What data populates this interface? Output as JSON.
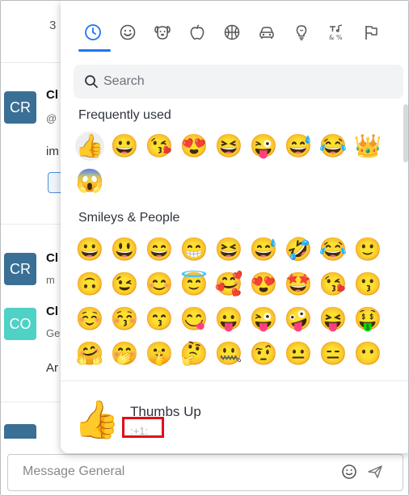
{
  "chat": {
    "unread_count": "3",
    "messages": [
      {
        "avatar": "CR",
        "name": "Cl",
        "handle": "@",
        "text": "im"
      },
      {
        "avatar": "CR",
        "name": "Cl",
        "handle": "m"
      },
      {
        "avatar": "CO",
        "name": "Cl",
        "handle": "Ge",
        "text": "Ar"
      }
    ]
  },
  "composer": {
    "placeholder": "Message General",
    "emoji_icon": "smiley-icon",
    "send_icon": "send-icon"
  },
  "picker": {
    "tabs": [
      {
        "icon": "clock-icon",
        "active": true
      },
      {
        "icon": "smiley-icon"
      },
      {
        "icon": "dog-icon"
      },
      {
        "icon": "apple-icon"
      },
      {
        "icon": "basketball-icon"
      },
      {
        "icon": "car-icon"
      },
      {
        "icon": "lightbulb-icon"
      },
      {
        "icon": "symbols-icon"
      },
      {
        "icon": "flag-icon"
      }
    ],
    "accent_color": "#1d74f5",
    "search_placeholder": "Search",
    "sections": [
      {
        "title": "Frequently used",
        "emojis": [
          "👍",
          "😀",
          "😘",
          "😍",
          "😆",
          "😜",
          "😅",
          "😂",
          "👑",
          "😱"
        ]
      },
      {
        "title": "Smileys & People",
        "emojis": [
          "😀",
          "😃",
          "😄",
          "😁",
          "😆",
          "😅",
          "🤣",
          "😂",
          "🙂",
          "🙃",
          "😉",
          "😊",
          "😇",
          "🥰",
          "😍",
          "🤩",
          "😘",
          "😗",
          "☺️",
          "😚",
          "😙",
          "😋",
          "😛",
          "😜",
          "🤪",
          "😝",
          "🤑",
          "🤗",
          "🤭",
          "🤫",
          "🤔",
          "🤐",
          "🤨",
          "😐",
          "😑",
          "😶"
        ]
      }
    ],
    "preview": {
      "emoji": "👍",
      "name": "Thumbs Up",
      "code": ":+1:"
    },
    "highlight_color": "#e00f1b"
  }
}
